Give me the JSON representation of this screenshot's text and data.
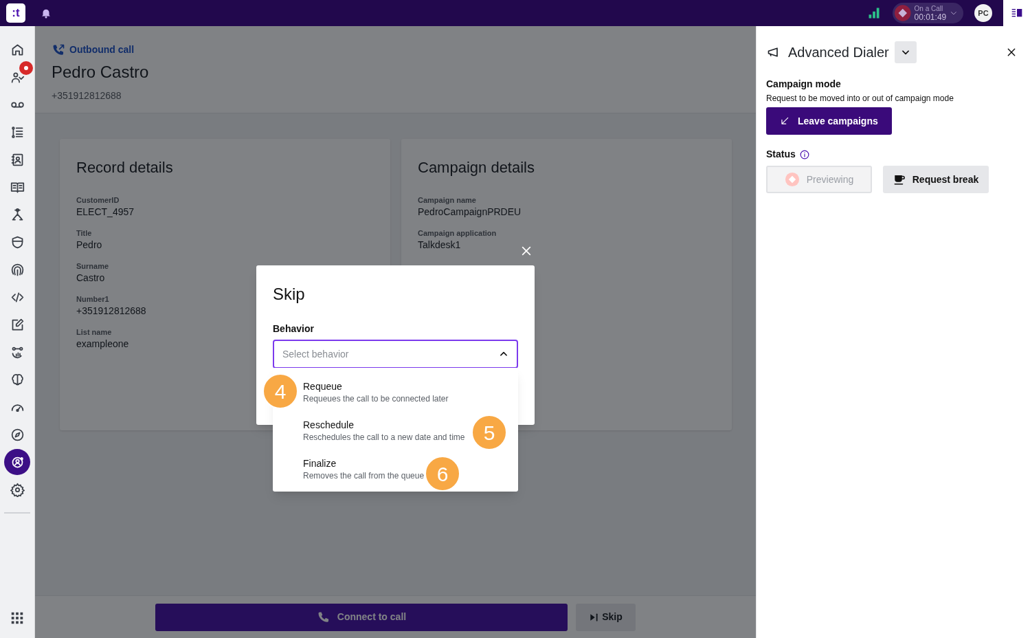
{
  "top_bar": {
    "logo": ":t",
    "call_status": {
      "label": "On a Call",
      "timer": "00:01:49"
    },
    "avatar": "PC"
  },
  "sidebar": {
    "items": [
      {
        "kind": "home",
        "selected": false,
        "notification": false
      },
      {
        "kind": "people",
        "selected": false,
        "notification": true
      },
      {
        "kind": "voicemail",
        "selected": false,
        "notification": false
      },
      {
        "kind": "list",
        "selected": false,
        "notification": false
      },
      {
        "kind": "contacts",
        "selected": false,
        "notification": false
      },
      {
        "kind": "book",
        "selected": false,
        "notification": false
      },
      {
        "kind": "flow",
        "selected": false,
        "notification": false
      },
      {
        "kind": "shield",
        "selected": false,
        "notification": false
      },
      {
        "kind": "fingerprint",
        "selected": false,
        "notification": false
      },
      {
        "kind": "code",
        "selected": false,
        "notification": false
      },
      {
        "kind": "edit",
        "selected": false,
        "notification": false
      },
      {
        "kind": "chart",
        "selected": false,
        "notification": false
      },
      {
        "kind": "brain",
        "selected": false,
        "notification": false
      },
      {
        "kind": "gauge",
        "selected": false,
        "notification": false
      },
      {
        "kind": "compass",
        "selected": false,
        "notification": false
      },
      {
        "kind": "agent",
        "selected": true,
        "notification": false
      },
      {
        "kind": "gear",
        "selected": false,
        "notification": false
      }
    ]
  },
  "contact": {
    "call_type": "Outbound call",
    "name": "Pedro Castro",
    "number": "+351912812688"
  },
  "cards": [
    {
      "title": "Record details",
      "fields": [
        {
          "label": "CustomerID",
          "value": "ELECT_4957"
        },
        {
          "label": "Title",
          "value": "Pedro"
        },
        {
          "label": "Surname",
          "value": "Castro"
        },
        {
          "label": "Number1",
          "value": "+351912812688"
        },
        {
          "label": "List name",
          "value": "exampleone"
        }
      ]
    },
    {
      "title": "Campaign details",
      "fields": [
        {
          "label": "Campaign name",
          "value": "PedroCampaignPRDEU"
        },
        {
          "label": "Campaign application",
          "value": "Talkdesk1"
        }
      ]
    }
  ],
  "modal": {
    "title": "Skip",
    "field_label": "Behavior",
    "placeholder": "Select behavior",
    "expanded": true,
    "options": [
      {
        "title": "Requeue",
        "description": "Requeues the call to be connected later",
        "marker": "4"
      },
      {
        "title": "Reschedule",
        "description": "Reschedules the call to a new date and time",
        "marker": "5"
      },
      {
        "title": "Finalize",
        "description": "Removes the call from the queue",
        "marker": "6"
      }
    ]
  },
  "bottom_bar": {
    "connect_button": "Connect to call",
    "skip_button": "Skip"
  },
  "panel": {
    "title": "Advanced Dialer",
    "campaign_mode": {
      "title": "Campaign mode",
      "description": "Request to be moved into or out of campaign mode",
      "button": "Leave campaigns"
    },
    "status": {
      "label": "Status",
      "buttons": [
        {
          "kind": "status",
          "label": "Previewing",
          "disabled": true
        },
        {
          "kind": "break",
          "label": "Request break",
          "disabled": false
        }
      ]
    }
  }
}
